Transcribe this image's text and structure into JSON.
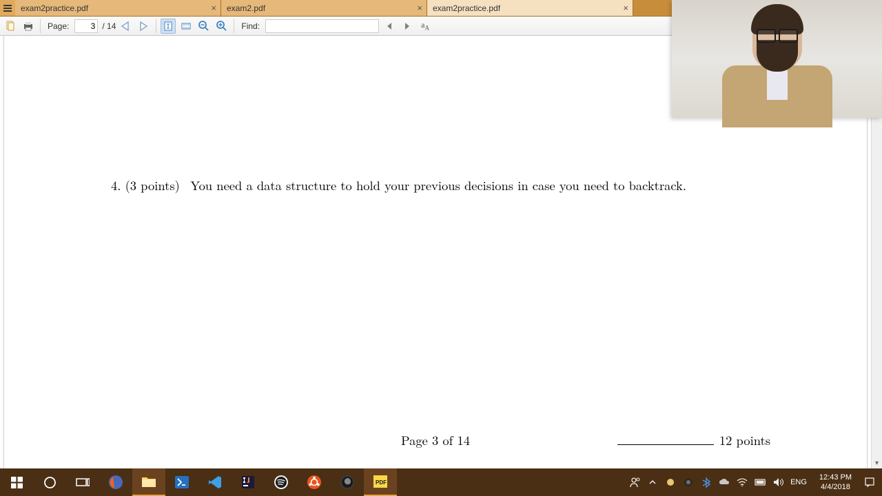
{
  "tabs": [
    {
      "title": "exam2practice.pdf",
      "active": false
    },
    {
      "title": "exam2.pdf",
      "active": false
    },
    {
      "title": "exam2practice.pdf",
      "active": true
    }
  ],
  "toolbar": {
    "page_label": "Page:",
    "page_current": "3",
    "page_total": "/ 14",
    "find_label": "Find:",
    "find_value": ""
  },
  "document": {
    "question_number": "4.",
    "question_points": "(3 points)",
    "question_text": "You need a data structure to hold your previous decisions in case you need to backtrack.",
    "footer_page": "Page 3 of 14",
    "footer_points": "12 points"
  },
  "systray": {
    "lang": "ENG",
    "time": "12:43 PM",
    "date": "4/4/2018"
  }
}
